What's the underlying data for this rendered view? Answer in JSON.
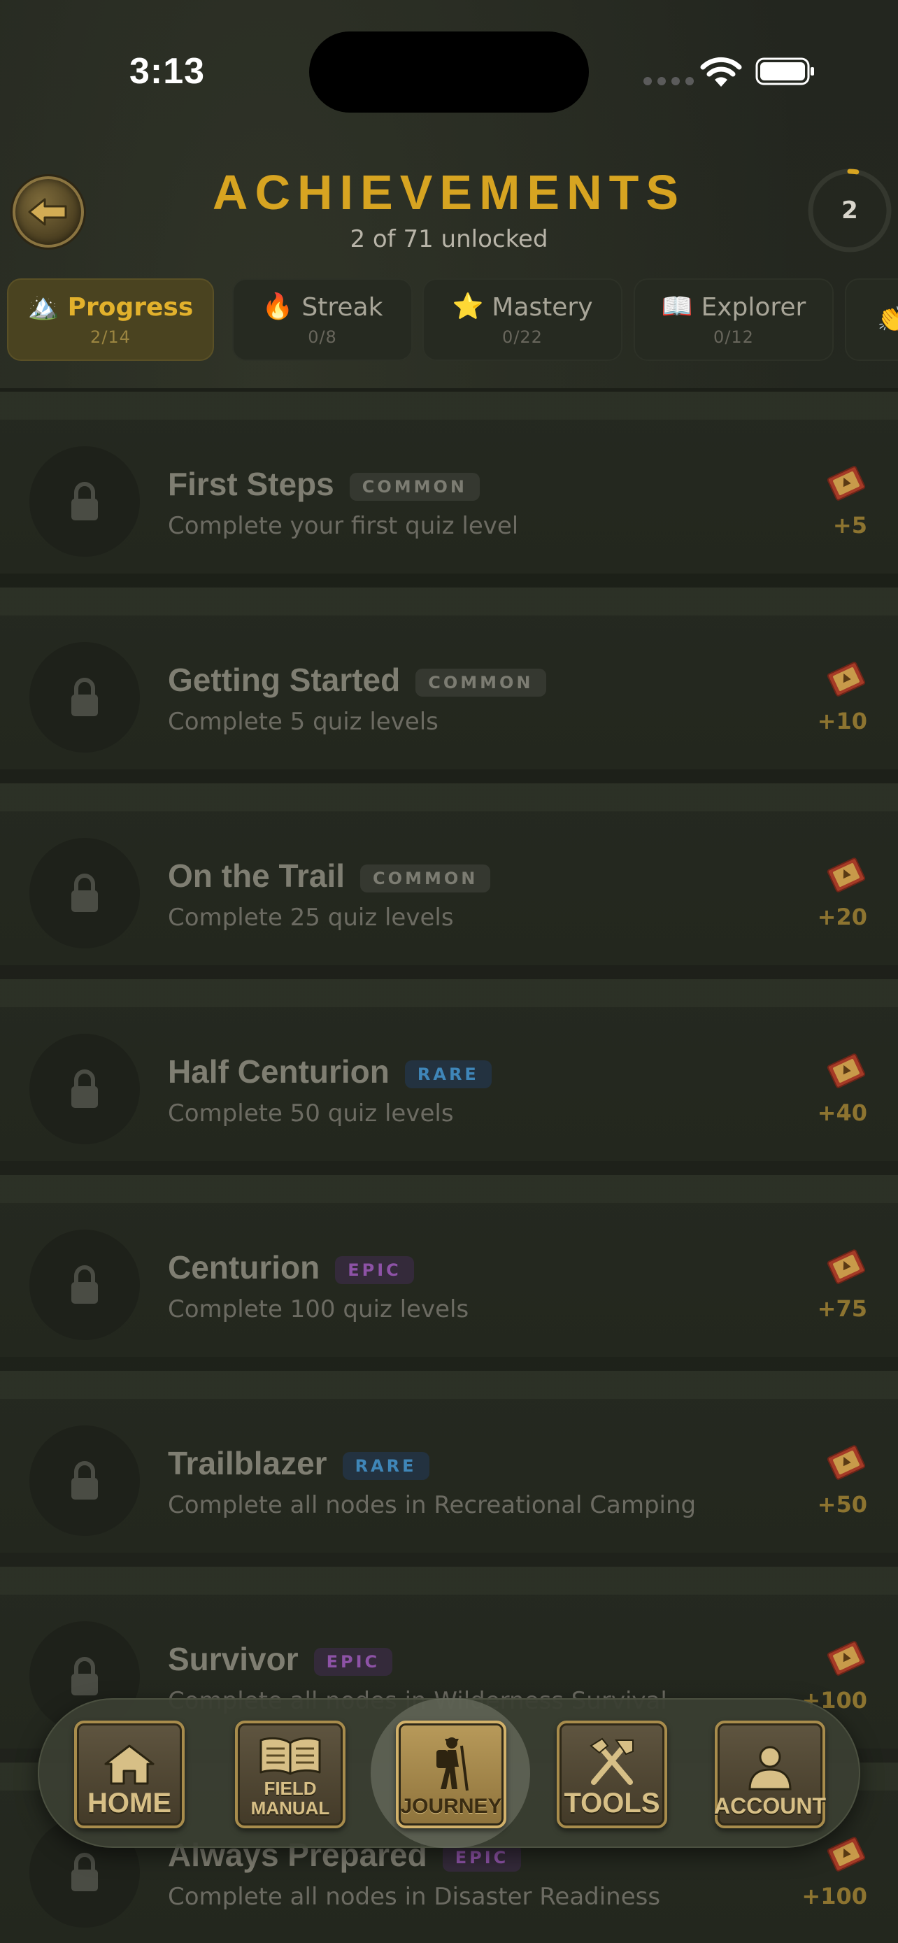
{
  "status_bar": {
    "time": "3:13"
  },
  "header": {
    "title": "ACHIEVEMENTS",
    "subtitle": "2 of 71 unlocked",
    "ring_count": "2",
    "ring_progress": 0.028
  },
  "tabs": [
    {
      "icon": "🏔️",
      "label": "Progress",
      "count": "2/14",
      "active": true
    },
    {
      "icon": "🔥",
      "label": "Streak",
      "count": "0/8"
    },
    {
      "icon": "⭐",
      "label": "Mastery",
      "count": "0/22"
    },
    {
      "icon": "📖",
      "label": "Explorer",
      "count": "0/12"
    },
    {
      "icon": "👏",
      "label": "",
      "count": ""
    }
  ],
  "achievements": [
    {
      "title": "First Steps",
      "rarity": "COMMON",
      "rarity_class": "common",
      "description": "Complete your first quiz level",
      "reward": "+5"
    },
    {
      "title": "Getting Started",
      "rarity": "COMMON",
      "rarity_class": "common",
      "description": "Complete 5 quiz levels",
      "reward": "+10"
    },
    {
      "title": "On the Trail",
      "rarity": "COMMON",
      "rarity_class": "common",
      "description": "Complete 25 quiz levels",
      "reward": "+20"
    },
    {
      "title": "Half Centurion",
      "rarity": "RARE",
      "rarity_class": "rare",
      "description": "Complete 50 quiz levels",
      "reward": "+40"
    },
    {
      "title": "Centurion",
      "rarity": "EPIC",
      "rarity_class": "epic",
      "description": "Complete 100 quiz levels",
      "reward": "+75"
    },
    {
      "title": "Trailblazer",
      "rarity": "RARE",
      "rarity_class": "rare",
      "description": "Complete all nodes in Recreational Camping",
      "reward": "+50"
    },
    {
      "title": "Survivor",
      "rarity": "EPIC",
      "rarity_class": "epic",
      "description": "Complete all nodes in Wilderness Survival",
      "reward": "+100"
    },
    {
      "title": "Always Prepared",
      "rarity": "EPIC",
      "rarity_class": "epic",
      "description": "Complete all nodes in Disaster Readiness",
      "reward": "+100"
    }
  ],
  "nav": {
    "home": "HOME",
    "field_manual_1": "FIELD",
    "field_manual_2": "MANUAL",
    "journey": "JOURNEY",
    "tools": "TOOLS",
    "account": "ACCOUNT"
  },
  "colors": {
    "accent": "#d7a421",
    "background": "#23261f",
    "common": "#7c7c72",
    "rare": "#3f86b8",
    "epic": "#8d52a6"
  }
}
